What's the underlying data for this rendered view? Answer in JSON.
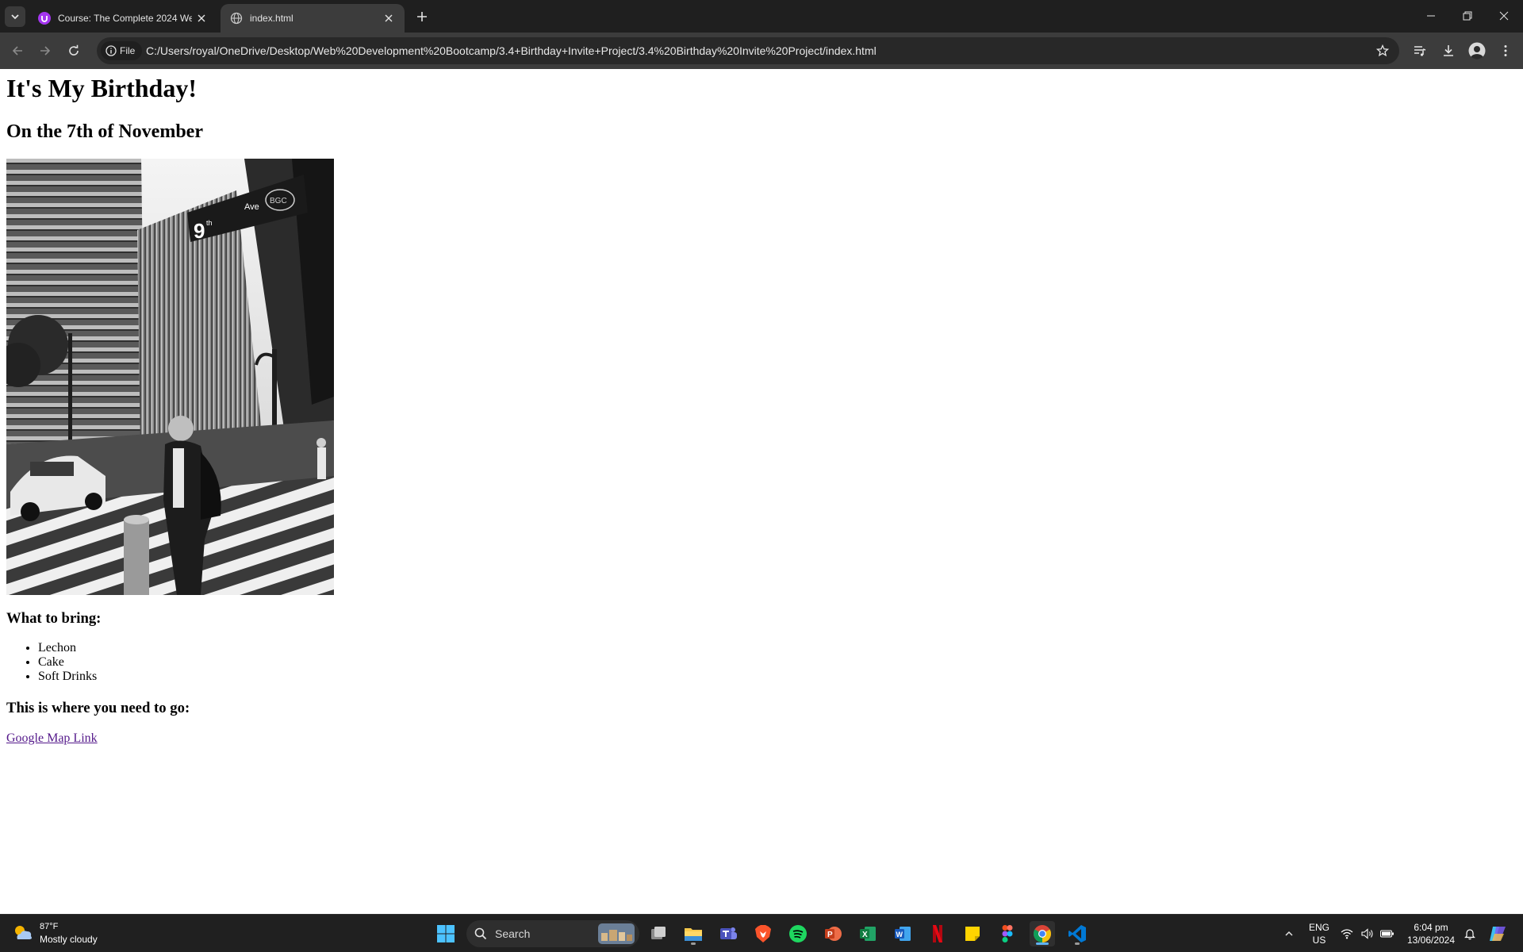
{
  "browser": {
    "tabs": [
      {
        "title": "Course: The Complete 2024 We",
        "favicon": "udemy-icon",
        "active": false
      },
      {
        "title": "index.html",
        "favicon": "globe-icon",
        "active": true
      }
    ],
    "address_chip": "File",
    "url": "C:/Users/royal/OneDrive/Desktop/Web%20Development%20Bootcamp/3.4+Birthday+Invite+Project/3.4%20Birthday%20Invite%20Project/index.html"
  },
  "page": {
    "heading": "It's My Birthday!",
    "subheading": "On the 7th of November",
    "bring_heading": "What to bring:",
    "bring_items": [
      "Lechon",
      "Cake",
      "Soft Drinks"
    ],
    "location_heading": "This is where you need to go:",
    "map_link": "Google Map Link",
    "photo_sign": {
      "number": "9",
      "suffix": "th",
      "word": "Ave",
      "badge": "BGC"
    }
  },
  "taskbar": {
    "weather": {
      "temp": "87°F",
      "condition": "Mostly cloudy"
    },
    "search_label": "Search",
    "apps": [
      "windows-start-icon",
      "task-view-icon",
      "file-explorer-icon",
      "teams-icon",
      "brave-icon",
      "spotify-icon",
      "powerpoint-icon",
      "excel-icon",
      "word-icon",
      "netflix-icon",
      "sticky-notes-icon",
      "figma-icon",
      "chrome-icon",
      "vscode-icon"
    ],
    "language": {
      "lang": "ENG",
      "region": "US"
    },
    "clock": {
      "time": "6:04 pm",
      "date": "13/06/2024"
    }
  },
  "colors": {
    "tab_strip": "#1f1f1f",
    "toolbar": "#3c3c3c",
    "visited_link": "#551a8b",
    "taskbar": "#202020"
  }
}
